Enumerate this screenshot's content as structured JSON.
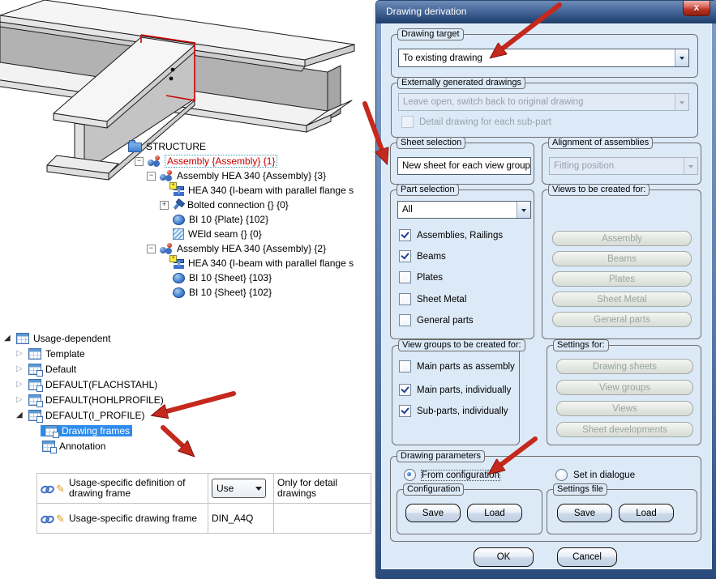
{
  "viewport": {
    "description": "3D view of two steel I-beams joined in a T connection with red highlighted end-plate edges and two bolts"
  },
  "structure_tree": {
    "items": [
      {
        "label": "STRUCTURE"
      },
      {
        "label": "Assembly {Assembly} {1}",
        "selected": true
      },
      {
        "label": "Assembly HEA 340 {Assembly} {3}"
      },
      {
        "label": "HEA 340 {I-beam with parallel flange s"
      },
      {
        "label": "Bolted connection {} {0}"
      },
      {
        "label": "BI 10 {Plate} {102}"
      },
      {
        "label": "WEld seam {} {0}"
      },
      {
        "label": "Assembly HEA 340 {Assembly} {2}"
      },
      {
        "label": "HEA 340 {I-beam with parallel flange s"
      },
      {
        "label": "BI 10 {Sheet} {103}"
      },
      {
        "label": "BI 10 {Sheet} {102}"
      }
    ]
  },
  "usage_tree": {
    "items": [
      {
        "label": "Usage-dependent"
      },
      {
        "label": "Template"
      },
      {
        "label": "Default"
      },
      {
        "label": "DEFAULT(FLACHSTAHL)"
      },
      {
        "label": "DEFAULT(HOHLPROFILE)"
      },
      {
        "label": "DEFAULT(I_PROFILE)"
      },
      {
        "label": "Drawing frames",
        "selected": true
      },
      {
        "label": "Annotation"
      }
    ]
  },
  "table": {
    "rows": [
      {
        "name": "Usage-specific definition of drawing frame",
        "value": "Use",
        "note": "Only for detail drawings"
      },
      {
        "name": "Usage-specific drawing frame",
        "value": "DIN_A4Q",
        "note": ""
      }
    ]
  },
  "dialog": {
    "title": "Drawing derivation",
    "drawing_target": {
      "label": "Drawing target",
      "value": "To existing drawing"
    },
    "external": {
      "label": "Externally generated drawings",
      "value": "Leave open, switch back to original drawing",
      "option": {
        "label": "Detail drawing for each sub-part",
        "checked": false
      }
    },
    "sheet_selection": {
      "label": "Sheet selection",
      "value": "New sheet for each view group"
    },
    "alignment": {
      "label": "Alignment of assemblies",
      "value": "Fitting position"
    },
    "part_selection": {
      "label": "Part selection",
      "value": "All",
      "options": [
        {
          "label": "Assemblies, Railings",
          "checked": true
        },
        {
          "label": "Beams",
          "checked": true
        },
        {
          "label": "Plates",
          "checked": false
        },
        {
          "label": "Sheet Metal",
          "checked": false
        },
        {
          "label": "General parts",
          "checked": false
        }
      ]
    },
    "views_for": {
      "label": "Views to be created for:",
      "buttons": [
        "Assembly",
        "Beams",
        "Plates",
        "Sheet Metal",
        "General parts"
      ]
    },
    "view_groups": {
      "label": "View groups to be created for:",
      "options": [
        {
          "label": "Main parts as assembly",
          "checked": false
        },
        {
          "label": "Main parts, individually",
          "checked": true
        },
        {
          "label": "Sub-parts, individually",
          "checked": true
        }
      ]
    },
    "settings_for": {
      "label": "Settings for:",
      "buttons": [
        "Drawing sheets",
        "View groups",
        "Views",
        "Sheet developments"
      ]
    },
    "drawing_parameters": {
      "label": "Drawing parameters",
      "radios": [
        {
          "label": "From configuration",
          "selected": true
        },
        {
          "label": "Set in dialogue",
          "selected": false
        }
      ],
      "configuration": {
        "label": "Configuration",
        "buttons": [
          "Save",
          "Load"
        ]
      },
      "settings_file": {
        "label": "Settings file",
        "buttons": [
          "Save",
          "Load"
        ]
      }
    },
    "ok": "OK",
    "cancel": "Cancel"
  },
  "colors": {
    "accent_selection": "#2e8ced",
    "highlight_red": "#c5281c",
    "dialog_bg": "#dce9f7",
    "titlebar": "#1d3c68"
  }
}
